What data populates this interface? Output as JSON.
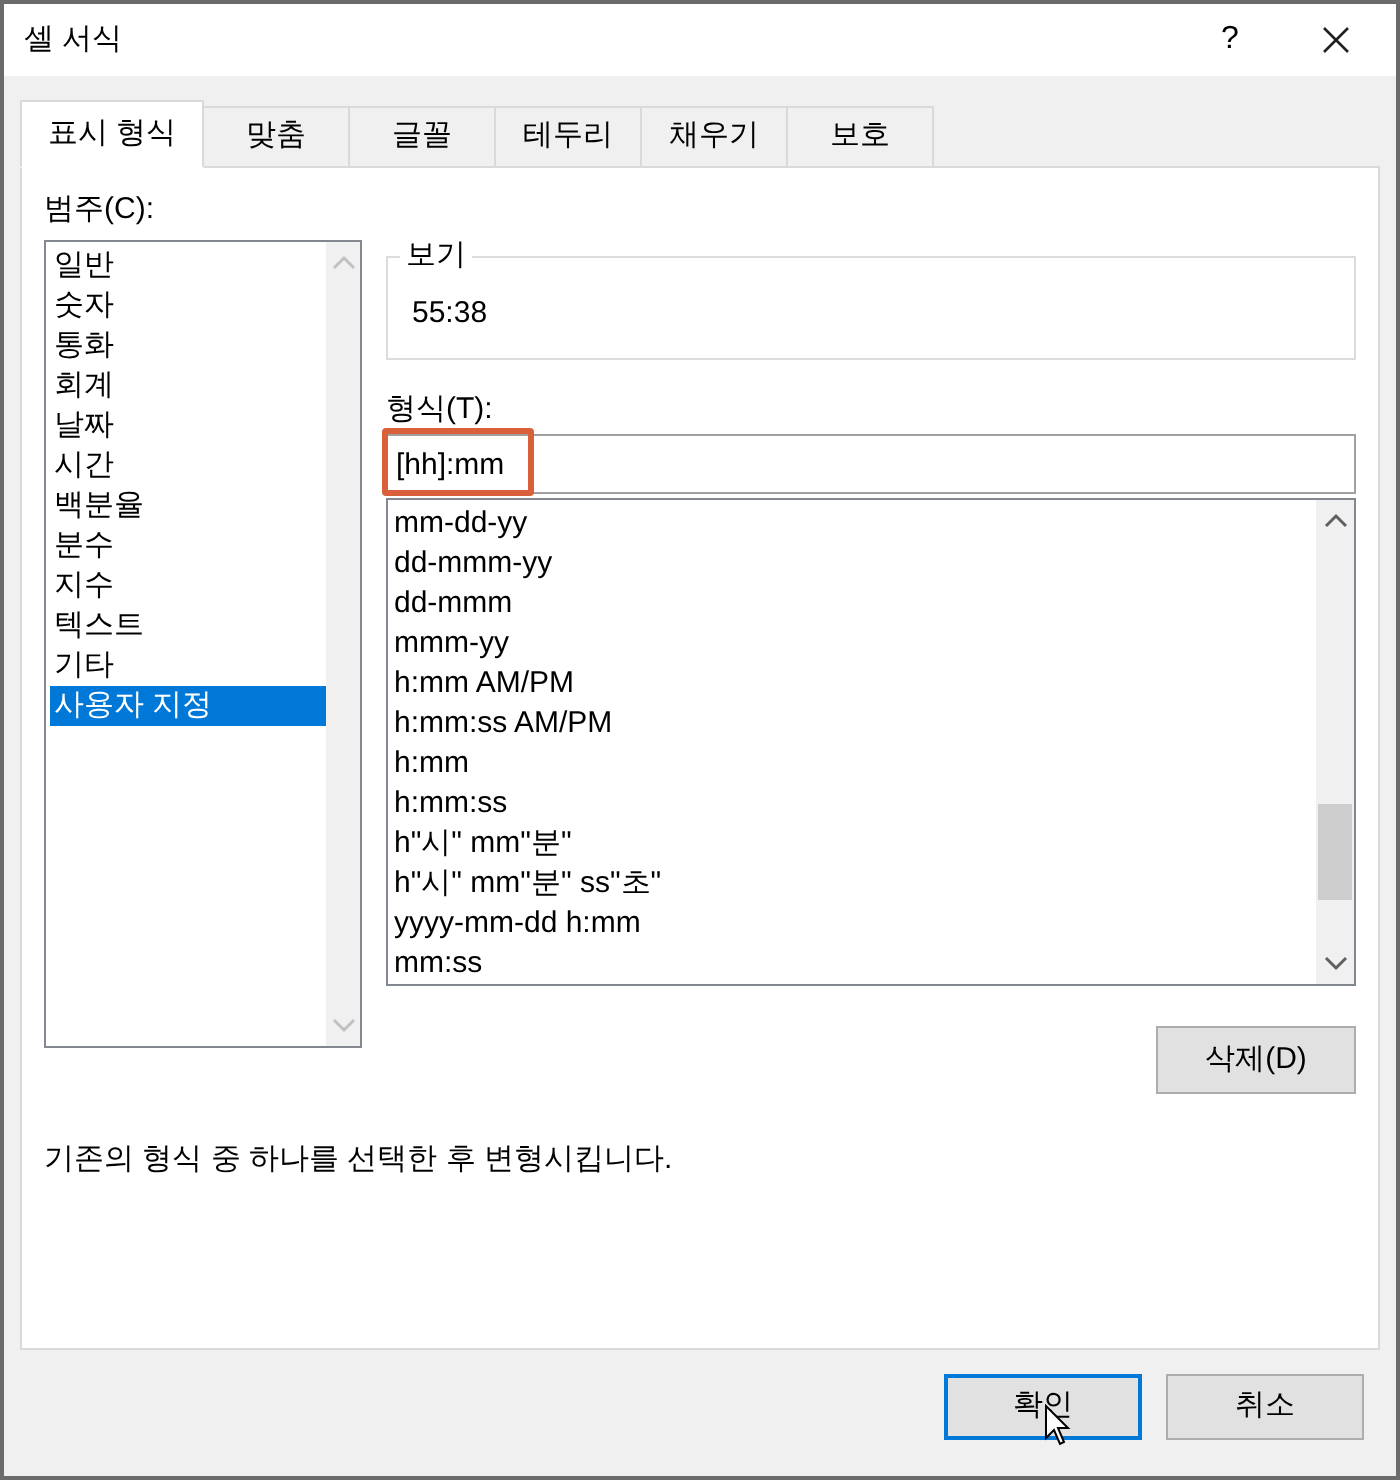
{
  "window": {
    "title": "셀 서식",
    "help": "?"
  },
  "tabs": [
    {
      "label": "표시 형식",
      "selected": true
    },
    {
      "label": "맞춤",
      "selected": false
    },
    {
      "label": "글꼴",
      "selected": false
    },
    {
      "label": "테두리",
      "selected": false
    },
    {
      "label": "채우기",
      "selected": false
    },
    {
      "label": "보호",
      "selected": false
    }
  ],
  "category_label": "범주(C):",
  "categories": [
    {
      "label": "일반",
      "selected": false
    },
    {
      "label": "숫자",
      "selected": false
    },
    {
      "label": "통화",
      "selected": false
    },
    {
      "label": "회계",
      "selected": false
    },
    {
      "label": "날짜",
      "selected": false
    },
    {
      "label": "시간",
      "selected": false
    },
    {
      "label": "백분율",
      "selected": false
    },
    {
      "label": "분수",
      "selected": false
    },
    {
      "label": "지수",
      "selected": false
    },
    {
      "label": "텍스트",
      "selected": false
    },
    {
      "label": "기타",
      "selected": false
    },
    {
      "label": "사용자 지정",
      "selected": true
    }
  ],
  "preview": {
    "label": "보기",
    "value": "55:38"
  },
  "format_label": "형식(T):",
  "format_field": {
    "value": "[hh]:mm",
    "highlighted": true
  },
  "formats": [
    "mm-dd-yy",
    "dd-mmm-yy",
    "dd-mmm",
    "mmm-yy",
    "h:mm AM/PM",
    "h:mm:ss AM/PM",
    "h:mm",
    "h:mm:ss",
    "h\"시\" mm\"분\"",
    "h\"시\" mm\"분\" ss\"초\"",
    "yyyy-mm-dd h:mm",
    "mm:ss"
  ],
  "delete_button": "삭제(D)",
  "description": "기존의 형식 중 하나를 선택한 후 변형시킵니다.",
  "buttons": [
    {
      "label": "확인",
      "focused": true
    },
    {
      "label": "취소",
      "focused": false
    }
  ]
}
